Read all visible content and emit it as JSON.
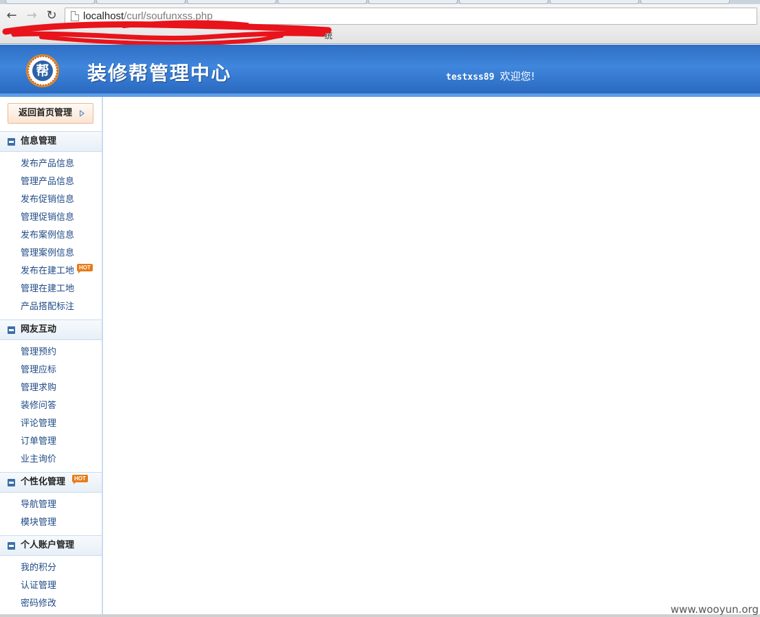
{
  "browser": {
    "url_host": "localhost",
    "url_path": "/curl/soufunxss.php",
    "bookmark_suffix": "统",
    "icons": {
      "back": "back-arrow-icon",
      "forward": "forward-arrow-icon",
      "reload": "reload-icon",
      "page": "page-icon"
    }
  },
  "header": {
    "logo_char": "帮",
    "title": "装修帮管理中心",
    "username": "testxss89",
    "welcome": "欢迎您!"
  },
  "sidebar": {
    "back_button": "返回首页管理",
    "sections": [
      {
        "title": "信息管理",
        "items": [
          "发布产品信息",
          "管理产品信息",
          "发布促销信息",
          "管理促销信息",
          "发布案例信息",
          "管理案例信息",
          "发布在建工地",
          "管理在建工地",
          "产品搭配标注"
        ]
      },
      {
        "title": "网友互动",
        "items": [
          "管理预约",
          "管理应标",
          "管理求购",
          "装修问答",
          "评论管理",
          "订单管理",
          "业主询价"
        ]
      },
      {
        "title": "个性化管理",
        "items": [
          "导航管理",
          "模块管理"
        ]
      },
      {
        "title": "个人账户管理",
        "items": [
          "我的积分",
          "认证管理",
          "密码修改"
        ]
      }
    ],
    "hot_badge": "HOT"
  },
  "watermark": "www.wooyun.org",
  "colors": {
    "header_blue": "#3f86dc",
    "menu_link": "#1f4a86",
    "hot_badge": "#e87a18",
    "redaction": "#e8131b"
  }
}
